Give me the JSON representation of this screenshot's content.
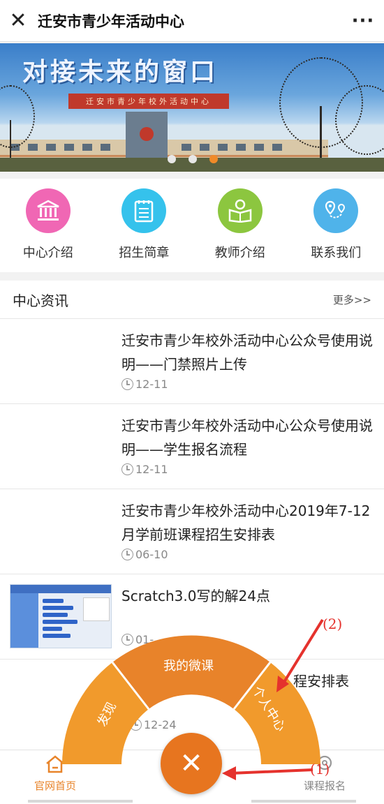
{
  "header": {
    "close_icon": "close-icon",
    "title": "迁安市青少年活动中心",
    "more_icon": "···"
  },
  "banner": {
    "slogan": "对接未来的窗口",
    "building_sign": "迁安市青少年校外活动中心",
    "slide_count": 3,
    "active_slide": 3
  },
  "quick_nav": [
    {
      "label": "中心介绍",
      "icon": "building-icon",
      "color": "#f067b4"
    },
    {
      "label": "招生简章",
      "icon": "document-icon",
      "color": "#35c2ec"
    },
    {
      "label": "教师介绍",
      "icon": "reader-icon",
      "color": "#8cc63f"
    },
    {
      "label": "联系我们",
      "icon": "map-pin-icon",
      "color": "#4fb3ea"
    }
  ],
  "news": {
    "title": "中心资讯",
    "more": "更多>>",
    "items": [
      {
        "title": "迁安市青少年校外活动中心公众号使用说明——门禁照片上传",
        "date": "12-11"
      },
      {
        "title": "迁安市青少年校外活动中心公众号使用说明——学生报名流程",
        "date": "12-11"
      },
      {
        "title": "迁安市青少年校外活动中心2019年7-12月学前班课程招生安排表",
        "date": "06-10"
      },
      {
        "title": "Scratch3.0写的解24点",
        "date": "01-"
      },
      {
        "title": "程安排表",
        "date": "12-24"
      }
    ]
  },
  "radial_menu": {
    "items": [
      "发现",
      "我的微课",
      "个人中心"
    ],
    "colors": {
      "outer": "#f19a2c",
      "middle": "#e8832a"
    },
    "center_icon": "close-icon"
  },
  "tabbar": {
    "home": "官网首页",
    "course": "课程报名"
  },
  "annotations": {
    "label_1": "(1)",
    "label_2": "(2)"
  },
  "colors": {
    "accent": "#e7751f",
    "annotation": "#e5322d"
  }
}
